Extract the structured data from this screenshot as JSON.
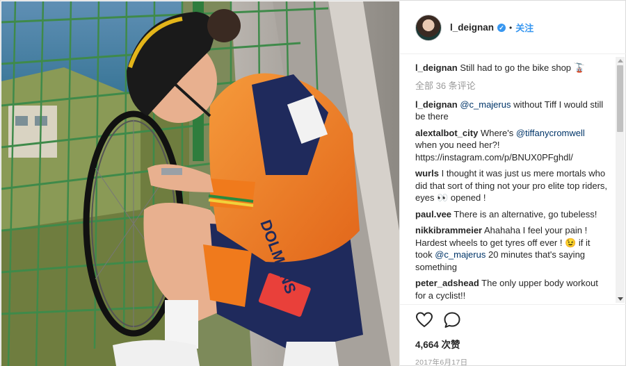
{
  "header": {
    "username": "l_deignan",
    "verified_icon": "verified-badge-icon",
    "separator": "•",
    "follow_label": "关注"
  },
  "caption": {
    "author": "l_deignan",
    "text": "Still had to go the bike shop 🚡"
  },
  "view_all_comments": "全部 36 条评论",
  "comments": [
    {
      "author": "l_deignan",
      "parts": [
        "@c_majerus",
        " without Tiff I would still be there"
      ]
    },
    {
      "author": "alextalbot_city",
      "parts": [
        "Where's ",
        "@tiffanycromwell",
        " when you need her?! https://instagram.com/p/BNUX0PFghdl/"
      ]
    },
    {
      "author": "wurls",
      "parts": [
        "I thought it was just us mere mortals who did that sort of thing not your pro elite top riders, eyes 👀 opened !"
      ]
    },
    {
      "author": "paul.vee",
      "parts": [
        "There is an alternative, go tubeless!"
      ]
    },
    {
      "author": "nikkibrammeier",
      "parts": [
        "Ahahaha I feel your pain ! Hardest wheels to get tyres off ever ! 😉 if it took ",
        "@c_majerus",
        " 20 minutes that's saying something"
      ]
    },
    {
      "author": "peter_adshead",
      "parts": [
        "The only upper body workout for a cyclist!!"
      ]
    }
  ],
  "actions": {
    "like_icon": "heart-icon",
    "comment_icon": "comment-bubble-icon",
    "likes_text": "4,664 次赞",
    "date_text": "2017年6月17日"
  },
  "colors": {
    "link": "#003569",
    "accent": "#3897f0",
    "muted": "#999999",
    "jersey_orange": "#f07a1c",
    "jersey_navy": "#1f2a5c"
  }
}
